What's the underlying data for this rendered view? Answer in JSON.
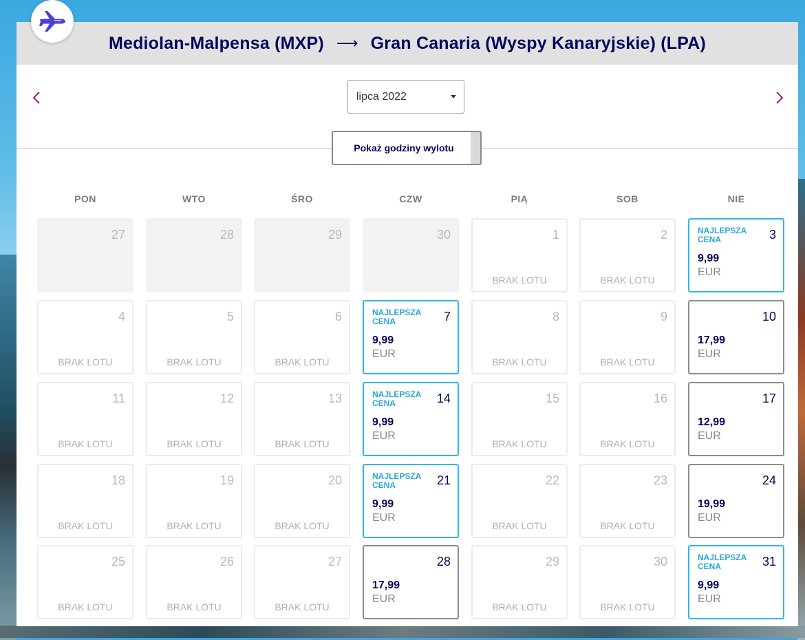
{
  "route": {
    "origin": "Mediolan-Malpensa (MXP)",
    "arrow": "⟶",
    "destination": "Gran Canaria (Wyspy Kanaryjskie) (LPA)"
  },
  "icons": {
    "plane": "plane-icon",
    "prev": "chevron-left-icon",
    "next": "chevron-right-icon",
    "caret": "caret-down-icon"
  },
  "colors": {
    "navy": "#06065e",
    "accent_magenta": "#b0157a",
    "best_blue": "#2eb7e6",
    "plane_purple": "#4b3fd6"
  },
  "month_select": {
    "value": "lipca 2022"
  },
  "show_hours_button": {
    "label": "Pokaż godziny wylotu"
  },
  "weekdays": [
    "PON",
    "WTO",
    "ŚRO",
    "CZW",
    "PIĄ",
    "SOB",
    "NIE"
  ],
  "labels": {
    "no_flight": "BRAK LOTU",
    "best_price": "NAJLEPSZA CENA",
    "currency": "EUR"
  },
  "weeks": [
    [
      {
        "day": "27",
        "state": "past"
      },
      {
        "day": "28",
        "state": "past"
      },
      {
        "day": "29",
        "state": "past"
      },
      {
        "day": "30",
        "state": "past"
      },
      {
        "day": "1",
        "state": "none"
      },
      {
        "day": "2",
        "state": "none"
      },
      {
        "day": "3",
        "state": "best",
        "price": "9,99"
      }
    ],
    [
      {
        "day": "4",
        "state": "none"
      },
      {
        "day": "5",
        "state": "none"
      },
      {
        "day": "6",
        "state": "none"
      },
      {
        "day": "7",
        "state": "best",
        "price": "9,99"
      },
      {
        "day": "8",
        "state": "none"
      },
      {
        "day": "9",
        "state": "none"
      },
      {
        "day": "10",
        "state": "avail",
        "price": "17,99"
      }
    ],
    [
      {
        "day": "11",
        "state": "none"
      },
      {
        "day": "12",
        "state": "none"
      },
      {
        "day": "13",
        "state": "none"
      },
      {
        "day": "14",
        "state": "best",
        "price": "9,99"
      },
      {
        "day": "15",
        "state": "none"
      },
      {
        "day": "16",
        "state": "none"
      },
      {
        "day": "17",
        "state": "avail",
        "price": "12,99"
      }
    ],
    [
      {
        "day": "18",
        "state": "none"
      },
      {
        "day": "19",
        "state": "none"
      },
      {
        "day": "20",
        "state": "none"
      },
      {
        "day": "21",
        "state": "best",
        "price": "9,99"
      },
      {
        "day": "22",
        "state": "none"
      },
      {
        "day": "23",
        "state": "none"
      },
      {
        "day": "24",
        "state": "avail",
        "price": "19,99"
      }
    ],
    [
      {
        "day": "25",
        "state": "none"
      },
      {
        "day": "26",
        "state": "none"
      },
      {
        "day": "27",
        "state": "none"
      },
      {
        "day": "28",
        "state": "avail",
        "price": "17,99"
      },
      {
        "day": "29",
        "state": "none"
      },
      {
        "day": "30",
        "state": "none"
      },
      {
        "day": "31",
        "state": "best",
        "price": "9,99"
      }
    ]
  ]
}
